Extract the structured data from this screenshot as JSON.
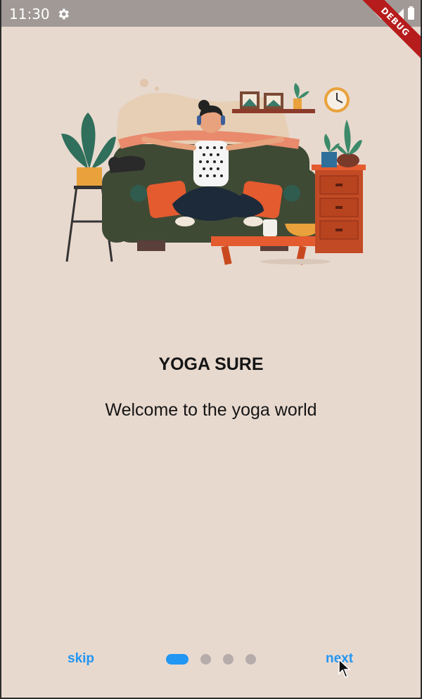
{
  "status_bar": {
    "time": "11:30",
    "debug_label": "DEBUG"
  },
  "onboarding": {
    "title": "YOGA SURE",
    "subtitle": "Welcome to the yoga world",
    "illustration": "woman-meditating-on-sofa-illustration"
  },
  "navigation": {
    "skip_label": "skip",
    "next_label": "next",
    "page_count": 4,
    "active_page": 1
  },
  "colors": {
    "background": "#e8d9cf",
    "status_bar": "#a19996",
    "accent": "#2196f3",
    "inactive_dot": "#b6acaa",
    "debug_ribbon": "#b71c1c"
  }
}
